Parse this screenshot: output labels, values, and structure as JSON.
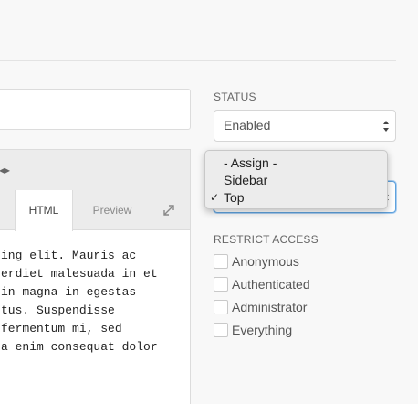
{
  "editor": {
    "tabs": {
      "html": "HTML",
      "preview": "Preview"
    },
    "toolbar_icon": "collapse-icon",
    "expand_icon": "expand-icon",
    "code_lines": [
      "ing elit. Mauris ac",
      "erdiet malesuada in et",
      "in magna in egestas",
      "tus. Suspendisse",
      "fermentum mi, sed",
      "a enim consequat dolor"
    ]
  },
  "sidebar": {
    "status": {
      "label": "STATUS",
      "value": "Enabled"
    },
    "position": {
      "options": [
        "- Assign -",
        "Sidebar",
        "Top"
      ],
      "selected": "Top",
      "check_mark": "✓"
    },
    "restrict_access": {
      "label": "RESTRICT ACCESS",
      "options": [
        "Anonymous",
        "Authenticated",
        "Administrator",
        "Everything"
      ]
    }
  },
  "colors": {
    "focus": "#5fa2dd",
    "background": "#f8f8f8"
  }
}
